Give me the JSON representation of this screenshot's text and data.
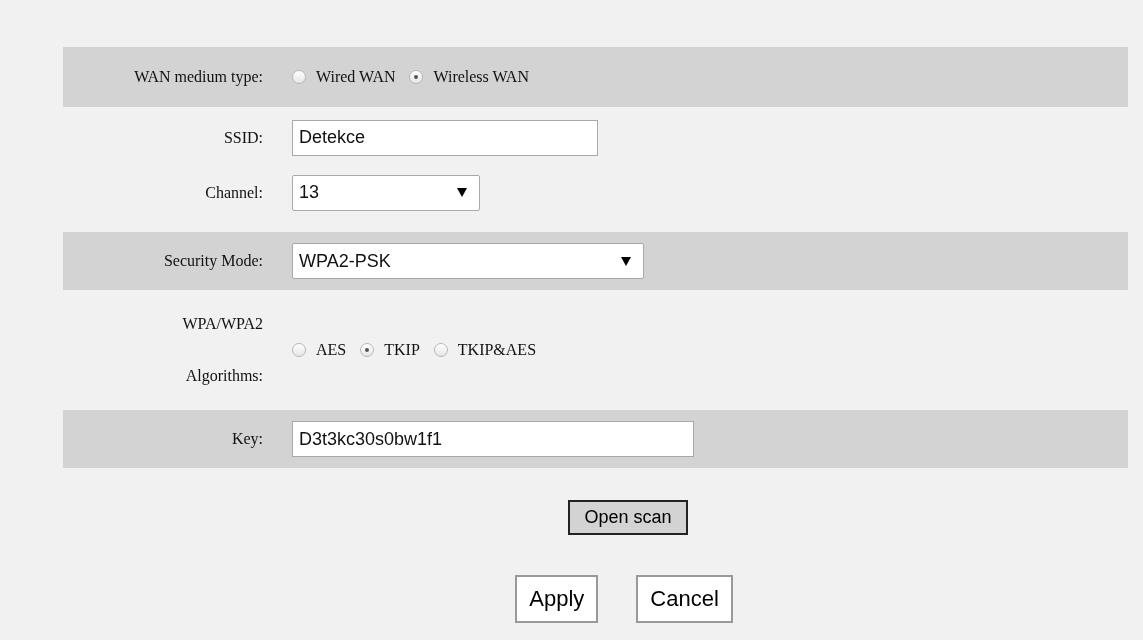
{
  "rows": [
    {
      "kind": "radio",
      "label": "WAN medium type:",
      "shaded": true,
      "options": [
        {
          "label": "Wired WAN",
          "selected": false
        },
        {
          "label": "Wireless WAN",
          "selected": true
        }
      ]
    },
    {
      "kind": "text",
      "label": "SSID:",
      "shaded": false,
      "value": "Detekce"
    },
    {
      "kind": "select",
      "label": "Channel:",
      "shaded": false,
      "value": "13"
    },
    {
      "kind": "select",
      "label": "Security Mode:",
      "shaded": true,
      "value": "WPA2-PSK"
    },
    {
      "kind": "radio",
      "label": "WPA/WPA2 Algorithms:",
      "shaded": false,
      "options": [
        {
          "label": "AES",
          "selected": false
        },
        {
          "label": "TKIP",
          "selected": true
        },
        {
          "label": "TKIP&AES",
          "selected": false
        }
      ]
    },
    {
      "kind": "text",
      "label": "Key:",
      "shaded": true,
      "value": "D3t3kc30s0bw1f1"
    }
  ],
  "scan_button": "Open scan",
  "buttons": [
    "Apply",
    "Cancel"
  ]
}
